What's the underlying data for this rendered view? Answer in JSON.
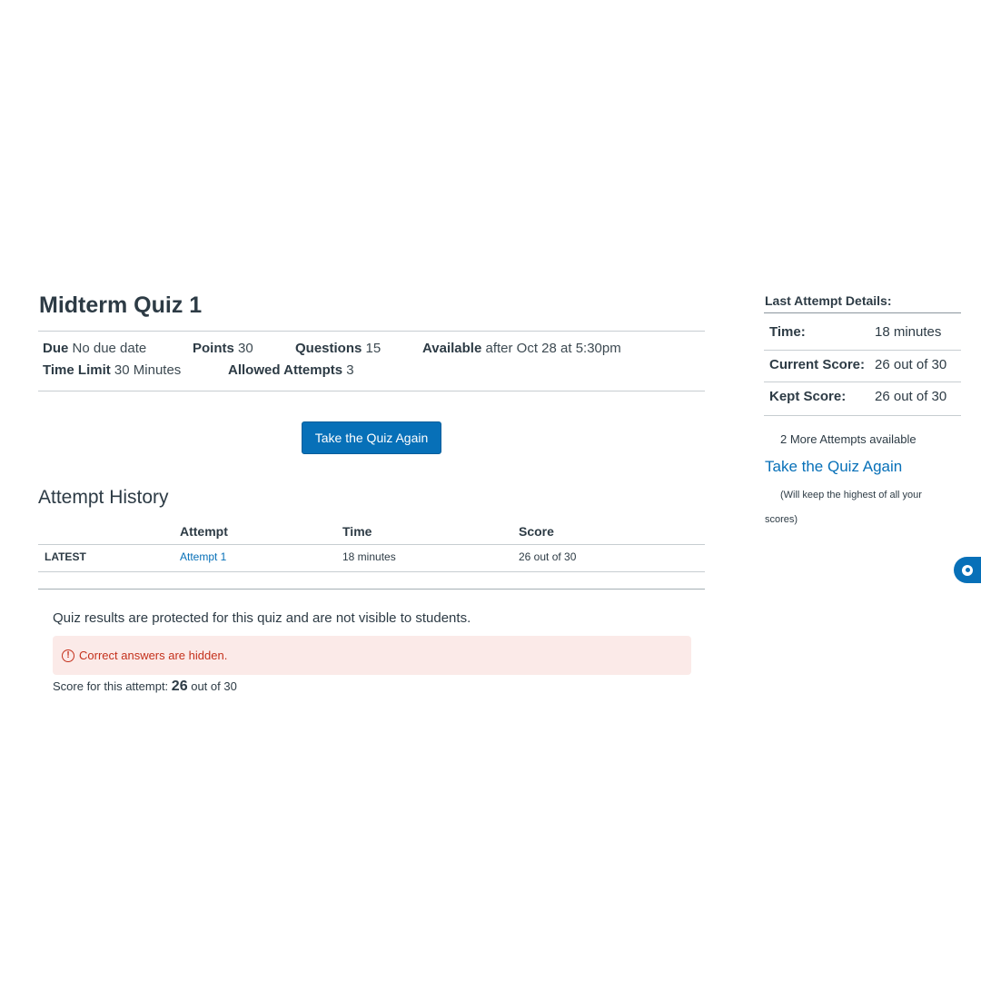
{
  "quiz": {
    "title": "Midterm Quiz 1",
    "due_label": "Due",
    "due_value": "No due date",
    "points_label": "Points",
    "points_value": "30",
    "questions_label": "Questions",
    "questions_value": "15",
    "available_label": "Available",
    "available_value": "after Oct 28 at 5:30pm",
    "time_limit_label": "Time Limit",
    "time_limit_value": "30 Minutes",
    "allowed_attempts_label": "Allowed Attempts",
    "allowed_attempts_value": "3",
    "take_again_button": "Take the Quiz Again"
  },
  "history": {
    "title": "Attempt History",
    "columns": [
      "",
      "Attempt",
      "Time",
      "Score"
    ],
    "rows": [
      {
        "tag": "LATEST",
        "attempt": "Attempt 1",
        "time": "18 minutes",
        "score": "26 out of 30"
      }
    ]
  },
  "results": {
    "protected_text": "Quiz results are protected for this quiz and are not visible to students.",
    "alert_text": "Correct answers are hidden.",
    "alert_icon": "!",
    "score_prefix": "Score for this attempt:",
    "score_value": "26",
    "score_suffix": "out of 30"
  },
  "sidebar": {
    "title": "Last Attempt Details:",
    "rows": [
      {
        "label": "Time:",
        "value": "18 minutes"
      },
      {
        "label": "Current Score:",
        "value": "26 out of 30"
      },
      {
        "label": "Kept Score:",
        "value": "26 out of 30"
      }
    ],
    "more_attempts": "2 More Attempts available",
    "take_again_link": "Take the Quiz Again",
    "keep_note": "(Will keep the highest of all your scores)"
  },
  "colors": {
    "primary": "#0770b8",
    "text": "#2d3b45",
    "alert_bg": "#fbeae8",
    "alert_text": "#c4311c",
    "divider": "#c7cdd1"
  },
  "icons": {
    "alert": "alert-circle-icon",
    "help": "help-chat-icon"
  }
}
